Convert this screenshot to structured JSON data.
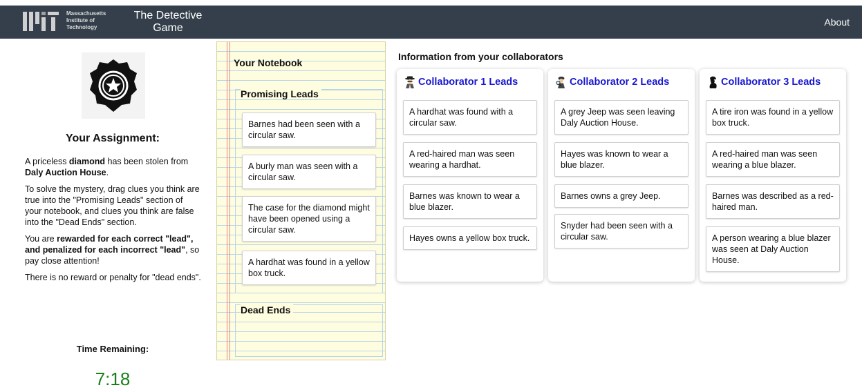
{
  "header": {
    "logo_line1": "Massachusetts",
    "logo_line2": "Institute of",
    "logo_line3": "Technology",
    "title_line1": "The Detective",
    "title_line2": "Game",
    "about_label": "About"
  },
  "assignment": {
    "badge_icon": "police-badge-icon",
    "title": "Your Assignment:",
    "p1_a": "A priceless ",
    "p1_b": "diamond",
    "p1_c": " has been stolen from ",
    "p1_d": "Daly Auction House",
    "p1_e": ".",
    "p2": "To solve the mystery, drag clues you think are true into the \"Promising Leads\" section of your notebook, and clues you think are false into the \"Dead Ends\" section.",
    "p3_a": "You are ",
    "p3_b": "rewarded for each correct \"lead\", and penalized for each incorrect \"lead\"",
    "p3_c": ", so pay close attention!",
    "p4": "There is no reward or penalty for \"dead ends\".",
    "time_label": "Time Remaining:",
    "time_value": "7:18"
  },
  "notebook": {
    "title": "Your Notebook",
    "promising_title": "Promising Leads",
    "promising": [
      "Barnes had been seen with a circular saw.",
      "A burly man was seen with a circular saw.",
      "The case for the diamond might have been opened using a circular saw.",
      "A hardhat was found in a yellow box truck."
    ],
    "dead_title": "Dead Ends"
  },
  "collaborators": {
    "heading": "Information from your collaborators",
    "panels": [
      {
        "title": "Collaborator 1 Leads",
        "icon": "spy-detective-icon",
        "leads": [
          "A hardhat was found with a circular saw.",
          "A red-haired man was seen wearing a hardhat.",
          "Barnes was known to wear a blue blazer.",
          "Hayes owns a yellow box truck."
        ]
      },
      {
        "title": "Collaborator 2 Leads",
        "icon": "magnifier-detective-icon",
        "leads": [
          "A grey Jeep was seen leaving Daly Auction House.",
          "Hayes was known to wear a blue blazer.",
          "Barnes owns a grey Jeep.",
          "Snyder had been seen with a circular saw."
        ]
      },
      {
        "title": "Collaborator 3 Leads",
        "icon": "sherlock-silhouette-icon",
        "leads": [
          "A tire iron was found in a yellow box truck.",
          "A red-haired man was seen wearing a blue blazer.",
          "Barnes was described as a red-haired man.",
          "A person wearing a blue blazer was seen at Daly Auction House."
        ]
      }
    ]
  },
  "colors": {
    "header_bg": "#343f4b",
    "collab_title": "#1818d0",
    "timer": "#1a7f1a",
    "notebook_bg": "#fffde0"
  }
}
